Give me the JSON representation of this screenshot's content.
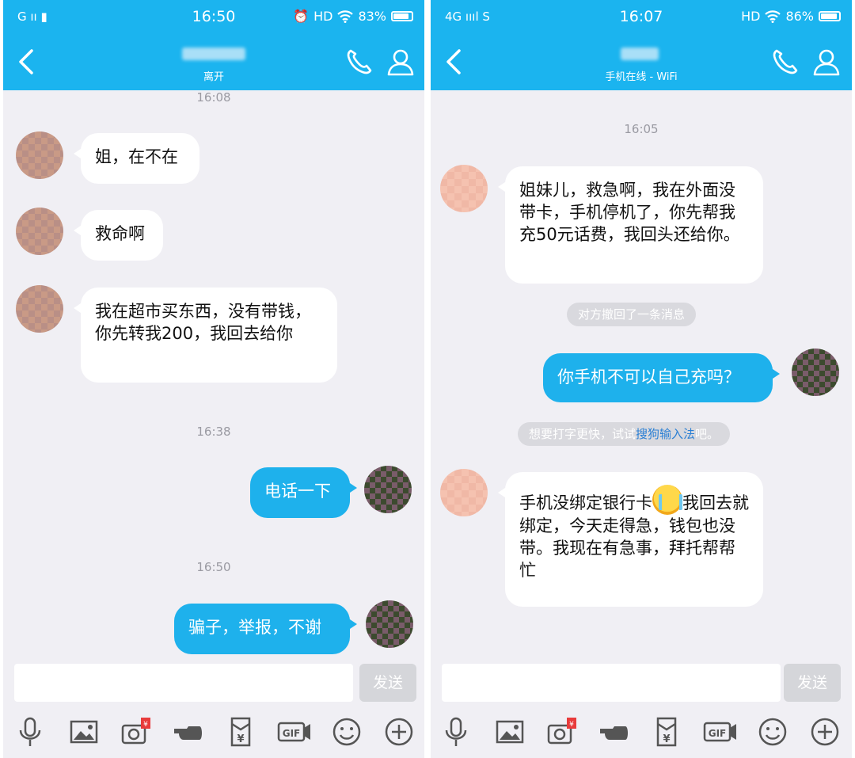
{
  "colors": {
    "accent": "#1bb4ef",
    "bubble_out": "#1eb1ec",
    "chat_bg": "#f0eff4",
    "link": "#2a7fd4"
  },
  "left": {
    "status_bar": {
      "carrier": "G ıı  ▮",
      "time": "16:50",
      "network": "HD",
      "battery": "83%",
      "battery_level": 0.83
    },
    "header": {
      "contact_status": "离开"
    },
    "messages": {
      "t1": "16:08",
      "m1": "姐，在不在",
      "m2": "救命啊",
      "m3": "我在超市买东西，没有带钱，你先转我200，我回去给你",
      "t2": "16:38",
      "m4": "电话一下",
      "t3": "16:50",
      "m5": "骗子，举报，不谢"
    },
    "input": {
      "send_label": "发送"
    }
  },
  "right": {
    "status_bar": {
      "carrier": "4G ıııl  S",
      "time": "16:07",
      "network": "HD",
      "battery": "86%",
      "battery_level": 0.86
    },
    "header": {
      "contact_status": "手机在线 - WiFi"
    },
    "messages": {
      "t1": "16:05",
      "m1": "姐妹儿，救急啊，我在外面没带卡，手机停机了，你先帮我充50元话费，我回头还给你。",
      "sys1": "对方撤回了一条消息",
      "m2": "你手机不可以自己充吗？",
      "sys2_prefix": "想要打字更快，试试",
      "sys2_link": "搜狗输入法",
      "sys2_suffix": "吧。",
      "m3_part1": "手机没绑定银行卡",
      "m3_part2": "我回去就绑定，今天走得急，钱包也没带。我现在有急事，拜托帮帮忙"
    },
    "input": {
      "send_label": "发送"
    }
  },
  "toolbar_icons": [
    "microphone-icon",
    "image-icon",
    "camera-redpacket-icon",
    "poke-hand-icon",
    "red-envelope-icon",
    "gif-icon",
    "emoji-icon",
    "plus-icon"
  ]
}
